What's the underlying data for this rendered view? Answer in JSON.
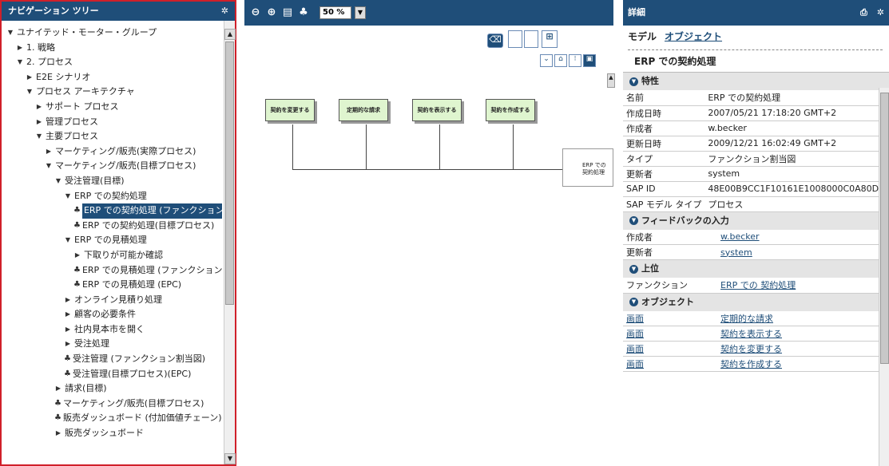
{
  "nav": {
    "title": "ナビゲーション ツリー",
    "tree": [
      {
        "label": "ユナイテッド・モーター・グループ",
        "indent": 0,
        "toggle": "down"
      },
      {
        "label": "1. 戦略",
        "indent": 1,
        "toggle": "right"
      },
      {
        "label": "2. プロセス",
        "indent": 1,
        "toggle": "down"
      },
      {
        "label": "E2E シナリオ",
        "indent": 2,
        "toggle": "right"
      },
      {
        "label": "プロセス アーキテクチャ",
        "indent": 2,
        "toggle": "down"
      },
      {
        "label": "サポート プロセス",
        "indent": 3,
        "toggle": "right"
      },
      {
        "label": "管理プロセス",
        "indent": 3,
        "toggle": "right"
      },
      {
        "label": "主要プロセス",
        "indent": 3,
        "toggle": "down"
      },
      {
        "label": "マーケティング/販売(実際プロセス)",
        "indent": 4,
        "toggle": "right"
      },
      {
        "label": "マーケティング/販売(目標プロセス)",
        "indent": 4,
        "toggle": "down"
      },
      {
        "label": "受注管理(目標)",
        "indent": 5,
        "toggle": "down"
      },
      {
        "label": "ERP での契約処理",
        "indent": 6,
        "toggle": "down"
      },
      {
        "label": "ERP での契約処理 (ファンクション割当図)",
        "indent": 7,
        "toggle": "model",
        "selected": true
      },
      {
        "label": "ERP での契約処理(目標プロセス)",
        "indent": 7,
        "toggle": "model"
      },
      {
        "label": "ERP での見積処理",
        "indent": 6,
        "toggle": "down"
      },
      {
        "label": "下取りが可能か確認",
        "indent": 7,
        "toggle": "right"
      },
      {
        "label": "ERP での見積処理 (ファンクション割当図)",
        "indent": 7,
        "toggle": "model"
      },
      {
        "label": "ERP での見積処理 (EPC)",
        "indent": 7,
        "toggle": "model"
      },
      {
        "label": "オンライン見積り処理",
        "indent": 6,
        "toggle": "right"
      },
      {
        "label": "顧客の必要条件",
        "indent": 6,
        "toggle": "right"
      },
      {
        "label": "社内見本市を開く",
        "indent": 6,
        "toggle": "right"
      },
      {
        "label": "受注処理",
        "indent": 6,
        "toggle": "right"
      },
      {
        "label": "受注管理 (ファンクション割当図)",
        "indent": 6,
        "toggle": "model"
      },
      {
        "label": "受注管理(目標プロセス)(EPC)",
        "indent": 6,
        "toggle": "model"
      },
      {
        "label": "請求(目標)",
        "indent": 5,
        "toggle": "right"
      },
      {
        "label": "マーケティング/販売(目標プロセス)",
        "indent": 5,
        "toggle": "model"
      },
      {
        "label": "販売ダッシュボード (付加価値チェーン)",
        "indent": 5,
        "toggle": "model"
      },
      {
        "label": "販売ダッシュボード",
        "indent": 5,
        "toggle": "right"
      }
    ]
  },
  "diagram": {
    "zoom": "50 %",
    "boxes": [
      "契約を変更する",
      "定期的な請求",
      "契約を表示する",
      "契約を作成する"
    ],
    "cut_box_text": "ERP での契約処理"
  },
  "details": {
    "title": "詳細",
    "tab_model": "モデル",
    "tab_object": "オブジェクト",
    "heading": "ERP での契約処理",
    "sections": {
      "attributes": "特性",
      "feedback": "フィードバックの入力",
      "parent": "上位",
      "objects": "オブジェクト"
    },
    "attributes": [
      {
        "k": "名前",
        "v": "ERP での契約処理"
      },
      {
        "k": "作成日時",
        "v": "2007/05/21 17:18:20 GMT+2"
      },
      {
        "k": "作成者",
        "v": "w.becker"
      },
      {
        "k": "更新日時",
        "v": "2009/12/21 16:02:49 GMT+2"
      },
      {
        "k": "タイプ",
        "v": "ファンクション割当図"
      },
      {
        "k": "更新者",
        "v": "system"
      },
      {
        "k": "SAP ID",
        "v": "48E00B9CC1F10161E1008000C0A80D"
      },
      {
        "k": "SAP モデル タイプ",
        "v": "プロセス"
      }
    ],
    "feedback": [
      {
        "k": "作成者",
        "v": "w.becker"
      },
      {
        "k": "更新者",
        "v": "system"
      }
    ],
    "parent": [
      {
        "k": "ファンクション",
        "v": "ERP での 契約処理"
      }
    ],
    "objects": [
      {
        "k": "画面",
        "v": "定期的な請求"
      },
      {
        "k": "画面",
        "v": "契約を表示する"
      },
      {
        "k": "画面",
        "v": "契約を変更する"
      },
      {
        "k": "画面",
        "v": "契約を作成する"
      }
    ]
  }
}
